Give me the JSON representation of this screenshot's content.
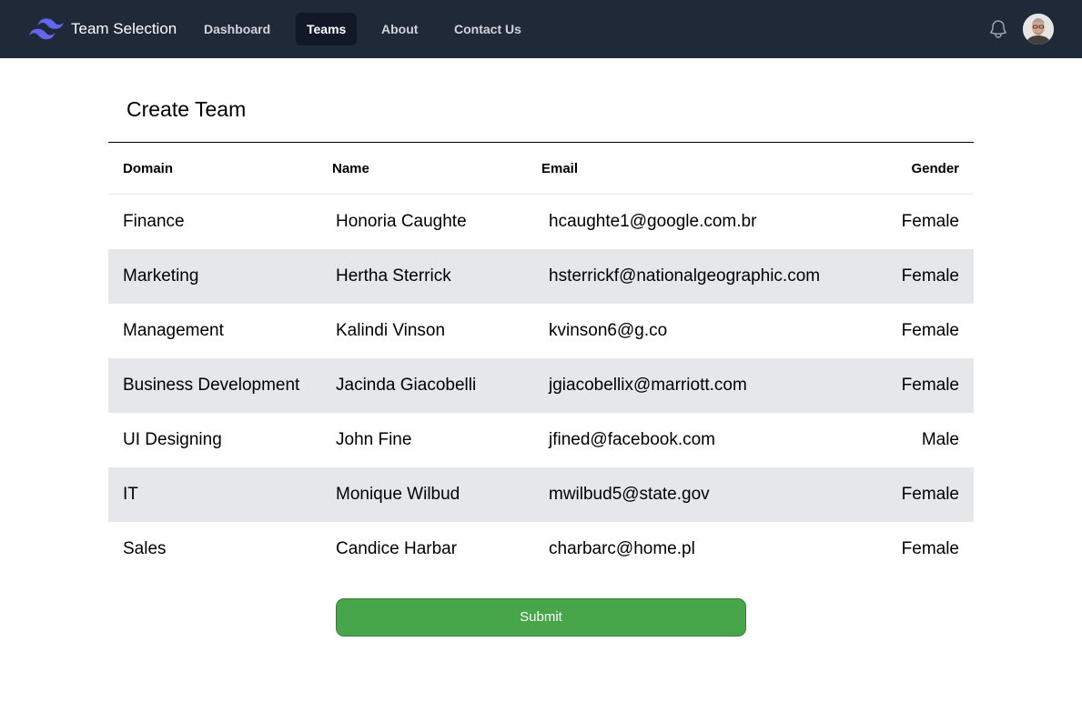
{
  "nav": {
    "brand": "Team Selection",
    "logo_icon": "tailwind-wave-icon",
    "accent_color": "#6366f1",
    "links": [
      "Dashboard",
      "Teams",
      "About",
      "Contact Us"
    ],
    "active_link": "Teams",
    "bell_icon": "bell-icon",
    "avatar_icon": "user-avatar"
  },
  "page": {
    "title": "Create Team"
  },
  "table": {
    "columns": [
      "Domain",
      "Name",
      "Email",
      "Gender"
    ],
    "rows": [
      {
        "domain": "Finance",
        "name": "Honoria Caughte",
        "email": "hcaughte1@google.com.br",
        "gender": "Female"
      },
      {
        "domain": "Marketing",
        "name": "Hertha Sterrick",
        "email": "hsterrickf@nationalgeographic.com",
        "gender": "Female"
      },
      {
        "domain": "Management",
        "name": "Kalindi Vinson",
        "email": "kvinson6@g.co",
        "gender": "Female"
      },
      {
        "domain": "Business Development",
        "name": "Jacinda Giacobelli",
        "email": "jgiacobellix@marriott.com",
        "gender": "Female"
      },
      {
        "domain": "UI Designing",
        "name": "John Fine",
        "email": "jfined@facebook.com",
        "gender": "Male"
      },
      {
        "domain": "IT",
        "name": "Monique Wilbud",
        "email": "mwilbud5@state.gov",
        "gender": "Female"
      },
      {
        "domain": "Sales",
        "name": "Candice Harbar",
        "email": "charbarc@home.pl",
        "gender": "Female"
      }
    ]
  },
  "submit": {
    "label": "Submit",
    "color": "#47a54a"
  }
}
